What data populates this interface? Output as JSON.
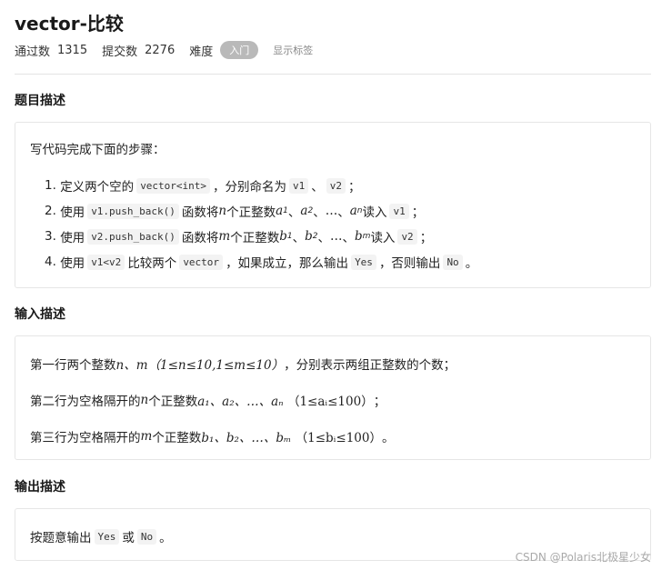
{
  "problem": {
    "title": "vector-比较",
    "stats": {
      "pass_label": "通过数",
      "pass_value": "1315",
      "submit_label": "提交数",
      "submit_value": "2276",
      "difficulty_label": "难度",
      "difficulty_value": "入门",
      "show_tags": "显示标签"
    }
  },
  "description": {
    "heading": "题目描述",
    "intro": "写代码完成下面的步骤：",
    "steps": [
      {
        "num": "1.",
        "t1": "定义两个空的",
        "c1": "vector<int>",
        "t2": "，分别命名为",
        "c2": "v1",
        "t3": "、",
        "c3": "v2",
        "t4": "；"
      },
      {
        "num": "2.",
        "t1": "使用",
        "c1": "v1.push_back()",
        "t2": "函数将",
        "var": "n",
        "t3": "个正整数",
        "seq": [
          "a",
          "1",
          "、",
          "a",
          "2",
          "、",
          "…",
          "、",
          "a",
          "n"
        ],
        "t4": "读入",
        "c2": "v1",
        "t5": "；"
      },
      {
        "num": "3.",
        "t1": "使用",
        "c1": "v2.push_back()",
        "t2": "函数将",
        "var": "m",
        "t3": "个正整数",
        "seq": [
          "b",
          "1",
          "、",
          "b",
          "2",
          "、",
          "…",
          "、",
          "b",
          "m"
        ],
        "t4": "读入",
        "c2": "v2",
        "t5": "；"
      },
      {
        "num": "4.",
        "t1": "使用",
        "c1": "v1<v2",
        "t2": "比较两个",
        "c2": "vector",
        "t3": "，如果成立，那么输出",
        "c3": "Yes",
        "t4": "，否则输出",
        "c4": "No",
        "t5": "。"
      }
    ]
  },
  "input": {
    "heading": "输入描述",
    "line1": {
      "t1": "第一行两个整数",
      "math": "n、m（1≤n≤10,1≤m≤10）",
      "t2": "，分别表示两组正整数的个数；"
    },
    "line2": {
      "t1": "第二行为空格隔开的",
      "var": "n",
      "t2": "个正整数",
      "seq": "a₁、a₂、…、aₙ",
      "range": "（1≤aᵢ≤100）",
      "t3": "；"
    },
    "line3": {
      "t1": "第三行为空格隔开的",
      "var": "m",
      "t2": "个正整数",
      "seq": "b₁、b₂、…、bₘ",
      "range": "（1≤bᵢ≤100）",
      "t3": "。"
    }
  },
  "output": {
    "heading": "输出描述",
    "t1": "按题意输出",
    "c1": "Yes",
    "t2": "或",
    "c2": "No",
    "t3": "。"
  },
  "watermark": "CSDN @Polaris北极星少女"
}
